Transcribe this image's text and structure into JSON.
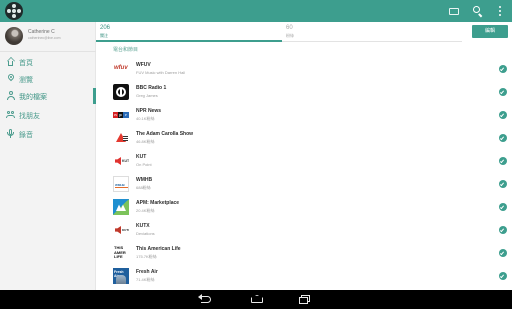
{
  "appbar": {
    "logo_icon": "tunein-logo-icon",
    "actions": [
      "cast-icon",
      "search-icon",
      "more-vert-icon"
    ],
    "accent_color": "#3d9e8e"
  },
  "profile": {
    "name": "Catherine C",
    "email": "catherinec@live.com"
  },
  "sidebar": {
    "items": [
      {
        "label": "首頁",
        "icon": "home-icon"
      },
      {
        "label": "瀏覽",
        "icon": "location-icon"
      },
      {
        "label": "我的檔案",
        "icon": "person-icon",
        "active": true
      },
      {
        "label": "找朋友",
        "icon": "friends-icon"
      },
      {
        "label": "錄音",
        "icon": "microphone-icon"
      }
    ]
  },
  "tabs": [
    {
      "count": "206",
      "label": "關注"
    },
    {
      "count": "60",
      "label": "粉絲"
    }
  ],
  "edit_label": "編輯",
  "section_title": "電台和節目",
  "stations": [
    {
      "title": "WFUV",
      "subtitle": "FUV Music with Darren Hall",
      "logo": "wfuv-logo"
    },
    {
      "title": "BBC Radio 1",
      "subtitle": "Greg James",
      "logo": "bbc-radio-1-logo"
    },
    {
      "title": "NPR News",
      "subtitle": "40.1K粉絲",
      "logo": "npr-logo"
    },
    {
      "title": "The Adam Carolla Show",
      "subtitle": "46.8K粉絲",
      "logo": "adam-carolla-logo"
    },
    {
      "title": "KUT",
      "subtitle": "On Point",
      "logo": "kut-logo"
    },
    {
      "title": "WMHB",
      "subtitle": "688粉絲",
      "logo": "wmhb-logo"
    },
    {
      "title": "APM: Marketplace",
      "subtitle": "20.4K粉絲",
      "logo": "apm-marketplace-logo"
    },
    {
      "title": "KUTX",
      "subtitle": "Deviations",
      "logo": "kutx-logo"
    },
    {
      "title": "This American Life",
      "subtitle": "175.7K粉絲",
      "logo": "this-american-life-logo"
    },
    {
      "title": "Fresh Air",
      "subtitle": "71.4K粉絲",
      "logo": "fresh-air-logo"
    }
  ],
  "tal_logo_text": "THIS AMER LIFE",
  "fresh_logo_text": "Fresh Air",
  "navbar": [
    "back-icon",
    "home-icon",
    "recent-apps-icon"
  ]
}
